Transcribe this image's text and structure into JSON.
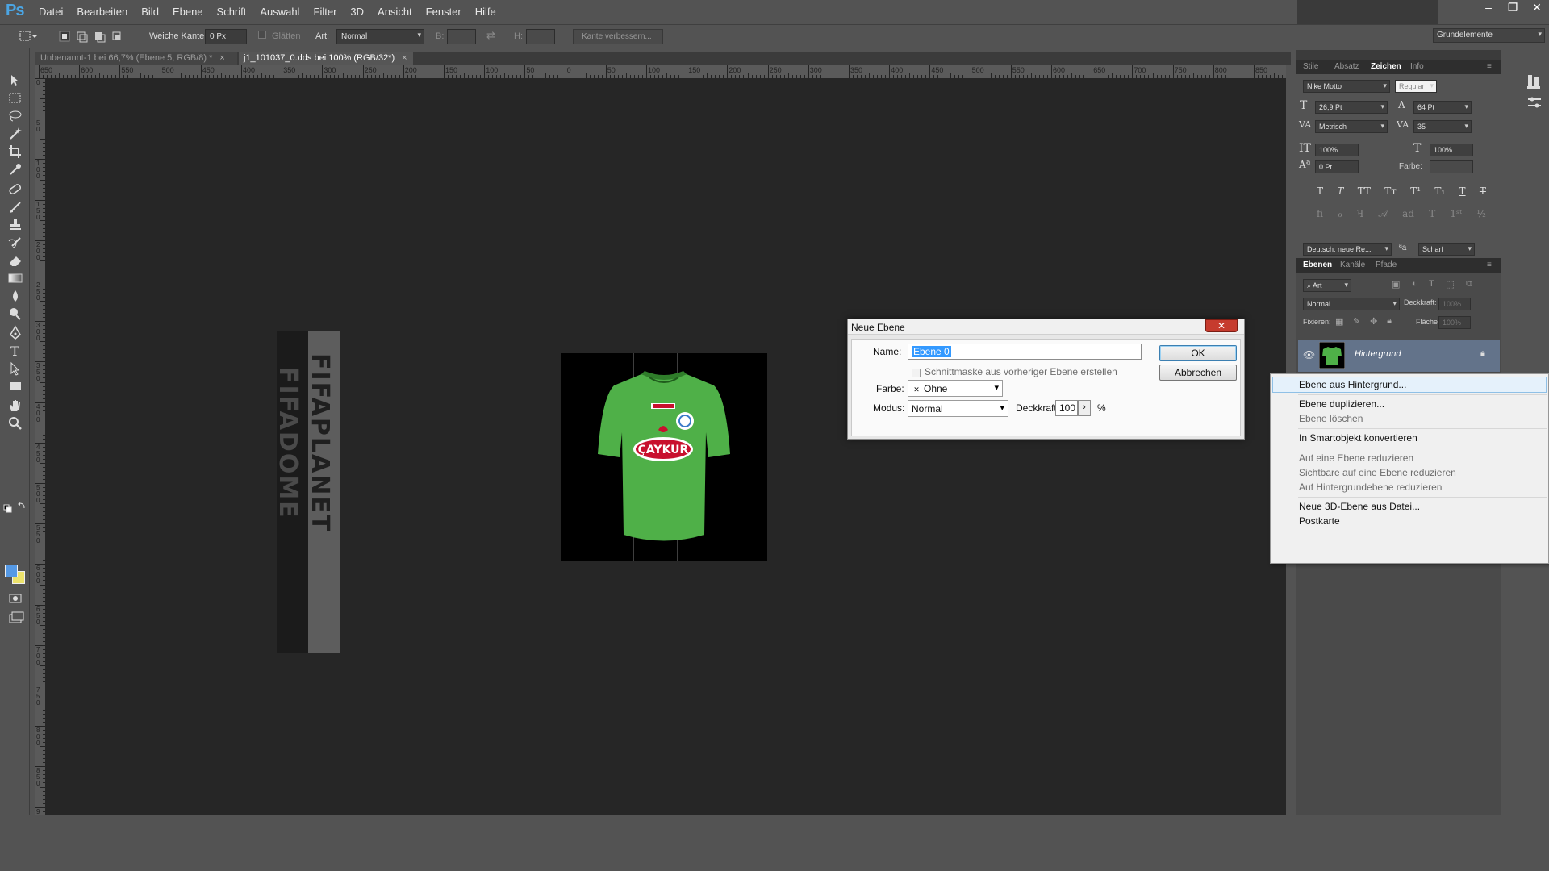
{
  "app": {
    "logo": "Ps"
  },
  "menu": [
    "Datei",
    "Bearbeiten",
    "Bild",
    "Ebene",
    "Schrift",
    "Auswahl",
    "Filter",
    "3D",
    "Ansicht",
    "Fenster",
    "Hilfe"
  ],
  "window_controls": [
    "–",
    "❐",
    "✕"
  ],
  "options_bar": {
    "feather_label": "Weiche Kante:",
    "feather_value": "0 Px",
    "antialias_label": "Glätten",
    "style_label": "Art:",
    "style_value": "Normal",
    "width_label": "B:",
    "height_label": "H:",
    "refine_edge_label": "Kante verbessern...",
    "workspace_value": "Grundelemente"
  },
  "document_tabs": [
    {
      "label": "Unbenannt-1 bei 66,7% (Ebene 5, RGB/8) *",
      "active": false
    },
    {
      "label": "j1_101037_0.dds bei 100% (RGB/32*)",
      "active": true
    }
  ],
  "ruler_h_labels": [
    "650",
    "600",
    "550",
    "500",
    "450",
    "400",
    "350",
    "300",
    "250",
    "200",
    "150",
    "100",
    "50",
    "0",
    "50",
    "100",
    "150",
    "200",
    "250",
    "300",
    "350",
    "400",
    "450",
    "500",
    "550",
    "600",
    "650",
    "700",
    "750",
    "800",
    "850"
  ],
  "ruler_v_labels": [
    "0",
    "50",
    "100",
    "150",
    "200",
    "250",
    "300",
    "350",
    "400",
    "450",
    "500",
    "550",
    "600",
    "650",
    "700",
    "750",
    "800",
    "850",
    "900"
  ],
  "canvas": {
    "banner_text_1": "FIFADOME",
    "banner_text_2": "FIFAPLANET"
  },
  "character_panel": {
    "tabs": [
      "Stile",
      "Absatz",
      "Zeichen",
      "Info"
    ],
    "active_tab": "Zeichen",
    "font_family": "Nike Motto",
    "font_style": "Regular",
    "font_size": "26,9 Pt",
    "leading": "64 Pt",
    "kerning": "Metrisch",
    "tracking": "35",
    "vertical_scale": "100%",
    "horizontal_scale": "100%",
    "baseline_shift": "0 Pt",
    "color_label": "Farbe:",
    "language": "Deutsch: neue Re...",
    "aa_label": "ªa",
    "antialias": "Scharf"
  },
  "layers_panel": {
    "tabs": [
      "Ebenen",
      "Kanäle",
      "Pfade"
    ],
    "active_tab": "Ebenen",
    "filter_kind": "Art",
    "blend_mode": "Normal",
    "opacity_label": "Deckkraft:",
    "opacity_value": "100%",
    "lock_label": "Fixieren:",
    "fill_label": "Fläche:",
    "fill_value": "100%",
    "layer_name": "Hintergrund"
  },
  "dialog": {
    "title": "Neue Ebene",
    "close": "✕",
    "name_label": "Name:",
    "name_value": "Ebene 0",
    "clip_mask_label": "Schnittmaske aus vorheriger Ebene erstellen",
    "color_label": "Farbe:",
    "color_x": "✕",
    "color_value": "Ohne",
    "mode_label": "Modus:",
    "mode_value": "Normal",
    "opacity_label": "Deckkraft:",
    "opacity_value": "100",
    "opacity_arrow": "›",
    "percent": "%",
    "ok_label": "OK",
    "cancel_label": "Abbrechen"
  },
  "context_menu": [
    {
      "label": "Ebene aus Hintergrund...",
      "enabled": true,
      "highlighted": true
    },
    {
      "label": "Ebene duplizieren...",
      "enabled": true
    },
    {
      "label": "Ebene löschen",
      "enabled": false
    },
    {
      "label": "In Smartobjekt konvertieren",
      "enabled": true
    },
    {
      "label": "Auf eine Ebene reduzieren",
      "enabled": false
    },
    {
      "label": "Sichtbare auf eine Ebene reduzieren",
      "enabled": false
    },
    {
      "label": "Auf Hintergrundebene reduzieren",
      "enabled": false
    },
    {
      "label": "Neue 3D-Ebene aus Datei...",
      "enabled": true
    },
    {
      "label": "Postkarte",
      "enabled": true
    }
  ],
  "colors": {
    "foreground": "#5599e5",
    "background": "#ece26b",
    "jersey_green": "#4fb048",
    "jersey_logo_red": "#c8102e",
    "selection_highlight": "#3399ff"
  },
  "icons": {
    "tools": [
      "move-tool-icon",
      "marquee-tool-icon",
      "lasso-tool-icon",
      "magic-wand-tool-icon",
      "crop-tool-icon",
      "eyedropper-tool-icon",
      "healing-brush-tool-icon",
      "brush-tool-icon",
      "clone-stamp-tool-icon",
      "history-brush-tool-icon",
      "eraser-tool-icon",
      "gradient-tool-icon",
      "blur-tool-icon",
      "dodge-tool-icon",
      "pen-tool-icon",
      "type-tool-icon",
      "path-selection-tool-icon",
      "rectangle-tool-icon",
      "hand-tool-icon",
      "zoom-tool-icon"
    ]
  }
}
